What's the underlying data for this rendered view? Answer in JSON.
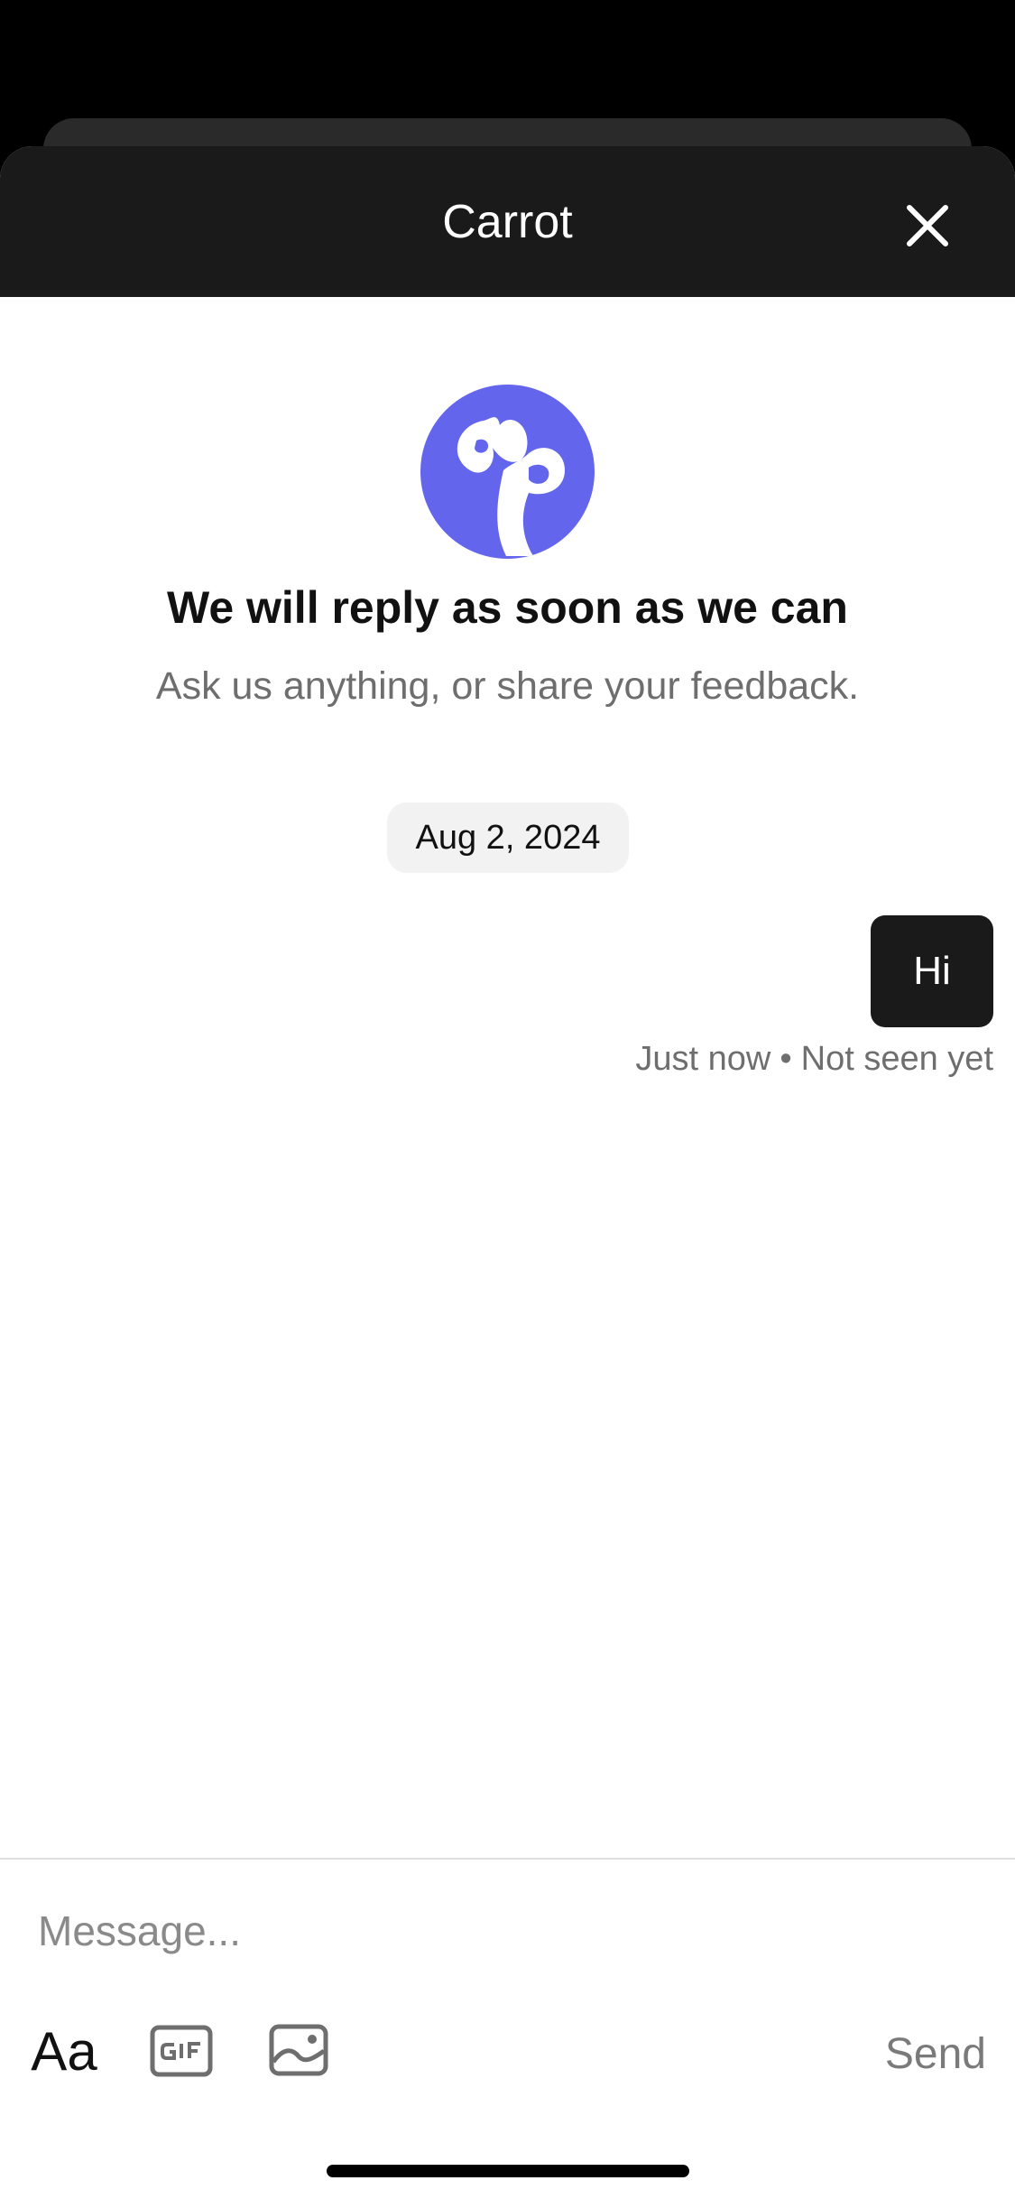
{
  "header": {
    "title": "Carrot"
  },
  "welcome": {
    "title": "We will reply as soon as we can",
    "subtitle": "Ask us anything, or share your feedback."
  },
  "conversation": {
    "date": "Aug 2, 2024",
    "messages": [
      {
        "text": "Hi",
        "time": "Just now",
        "separator": "•",
        "status": "Not seen yet"
      }
    ]
  },
  "composer": {
    "placeholder": "Message...",
    "font_button": "Aa",
    "send_label": "Send"
  },
  "colors": {
    "header_bg": "#1a1a1a",
    "avatar_bg": "#6366ec",
    "bubble_bg": "#1a1a1a",
    "pill_bg": "#f2f2f2",
    "muted_text": "#6e6e6e"
  },
  "icons": [
    "close-icon",
    "brand-logo-icon",
    "gif-icon",
    "image-icon"
  ]
}
